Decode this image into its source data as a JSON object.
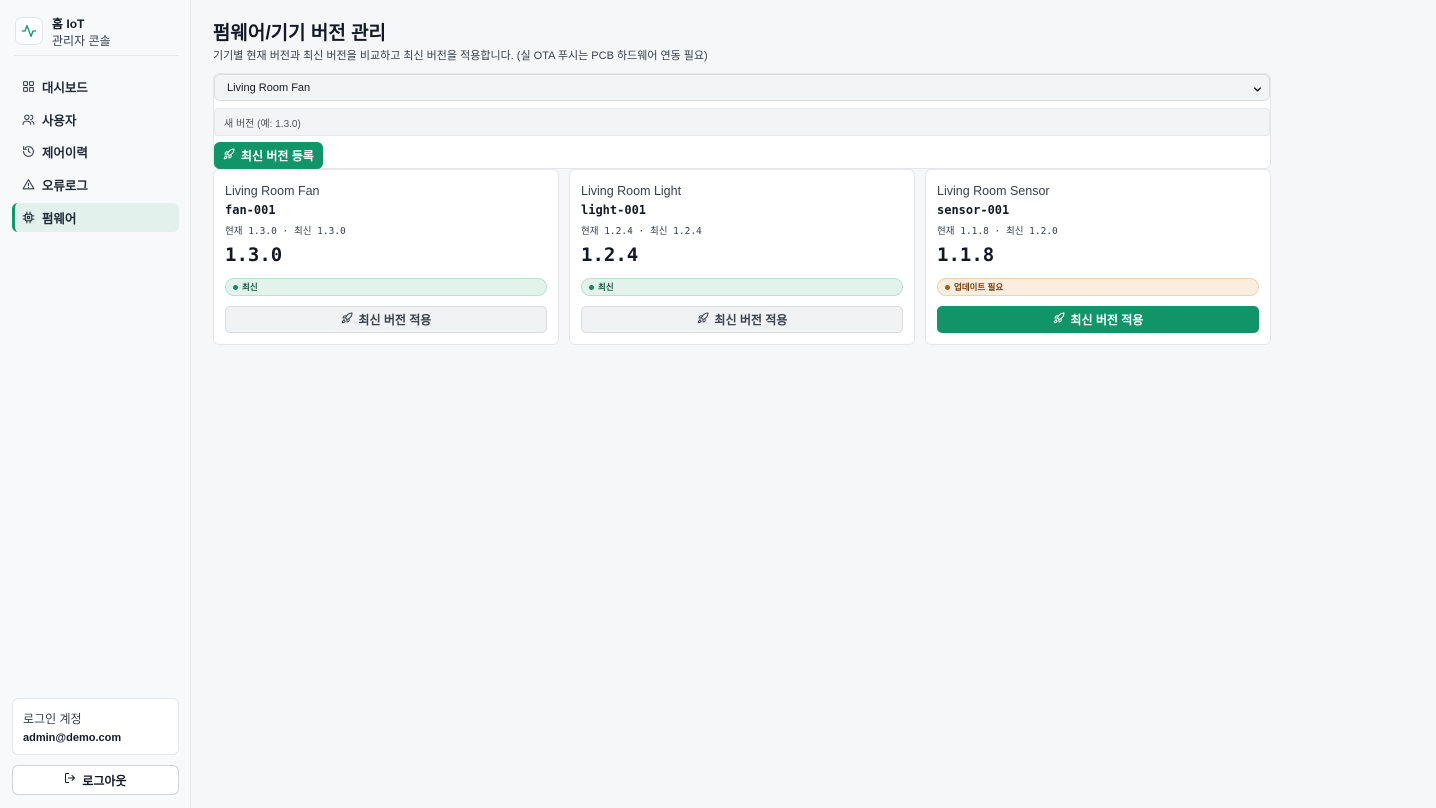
{
  "brand": {
    "title": "홈 IoT",
    "subtitle": "관리자 콘솔",
    "icon": "activity-icon"
  },
  "sidebar": {
    "items": [
      {
        "label": "대시보드",
        "icon": "grid-icon",
        "active": false
      },
      {
        "label": "사용자",
        "icon": "users-icon",
        "active": false
      },
      {
        "label": "제어이력",
        "icon": "history-icon",
        "active": false
      },
      {
        "label": "오류로그",
        "icon": "warning-icon",
        "active": false
      },
      {
        "label": "펌웨어",
        "icon": "chip-icon",
        "active": true
      }
    ],
    "account_label": "로그인 계정",
    "account_email": "admin@demo.com",
    "logout_label": "로그아웃"
  },
  "main": {
    "title": "펌웨어/기기 버전 관리",
    "description": "기기별 현재 버전과 최신 버전을 비교하고 최신 버전을 적용합니다. (실 OTA 푸시는 PCB 하드웨어 연동 필요)",
    "register": {
      "selected_device": "Living Room Fan",
      "version_placeholder": "새 버전 (예: 1.3.0)",
      "register_label": "최신 버전 등록"
    },
    "cards": [
      {
        "name": "Living Room Fan",
        "device_id": "fan-001",
        "versions_text": "현재 1.3.0 · 최신 1.3.0",
        "current": "1.3.0",
        "badge": "최신",
        "status": "ok",
        "apply_label": "최신 버전 적용",
        "apply_enabled": false
      },
      {
        "name": "Living Room Light",
        "device_id": "light-001",
        "versions_text": "현재 1.2.4 · 최신 1.2.4",
        "current": "1.2.4",
        "badge": "최신",
        "status": "ok",
        "apply_label": "최신 버전 적용",
        "apply_enabled": false
      },
      {
        "name": "Living Room Sensor",
        "device_id": "sensor-001",
        "versions_text": "현재 1.1.8 · 최신 1.2.0",
        "current": "1.1.8",
        "badge": "업데이트 필요",
        "status": "warn",
        "apply_label": "최신 버전 적용",
        "apply_enabled": true
      }
    ]
  },
  "colors": {
    "accent": "#119467",
    "accent_light": "#e3f1ec",
    "warning": "#b45309"
  }
}
